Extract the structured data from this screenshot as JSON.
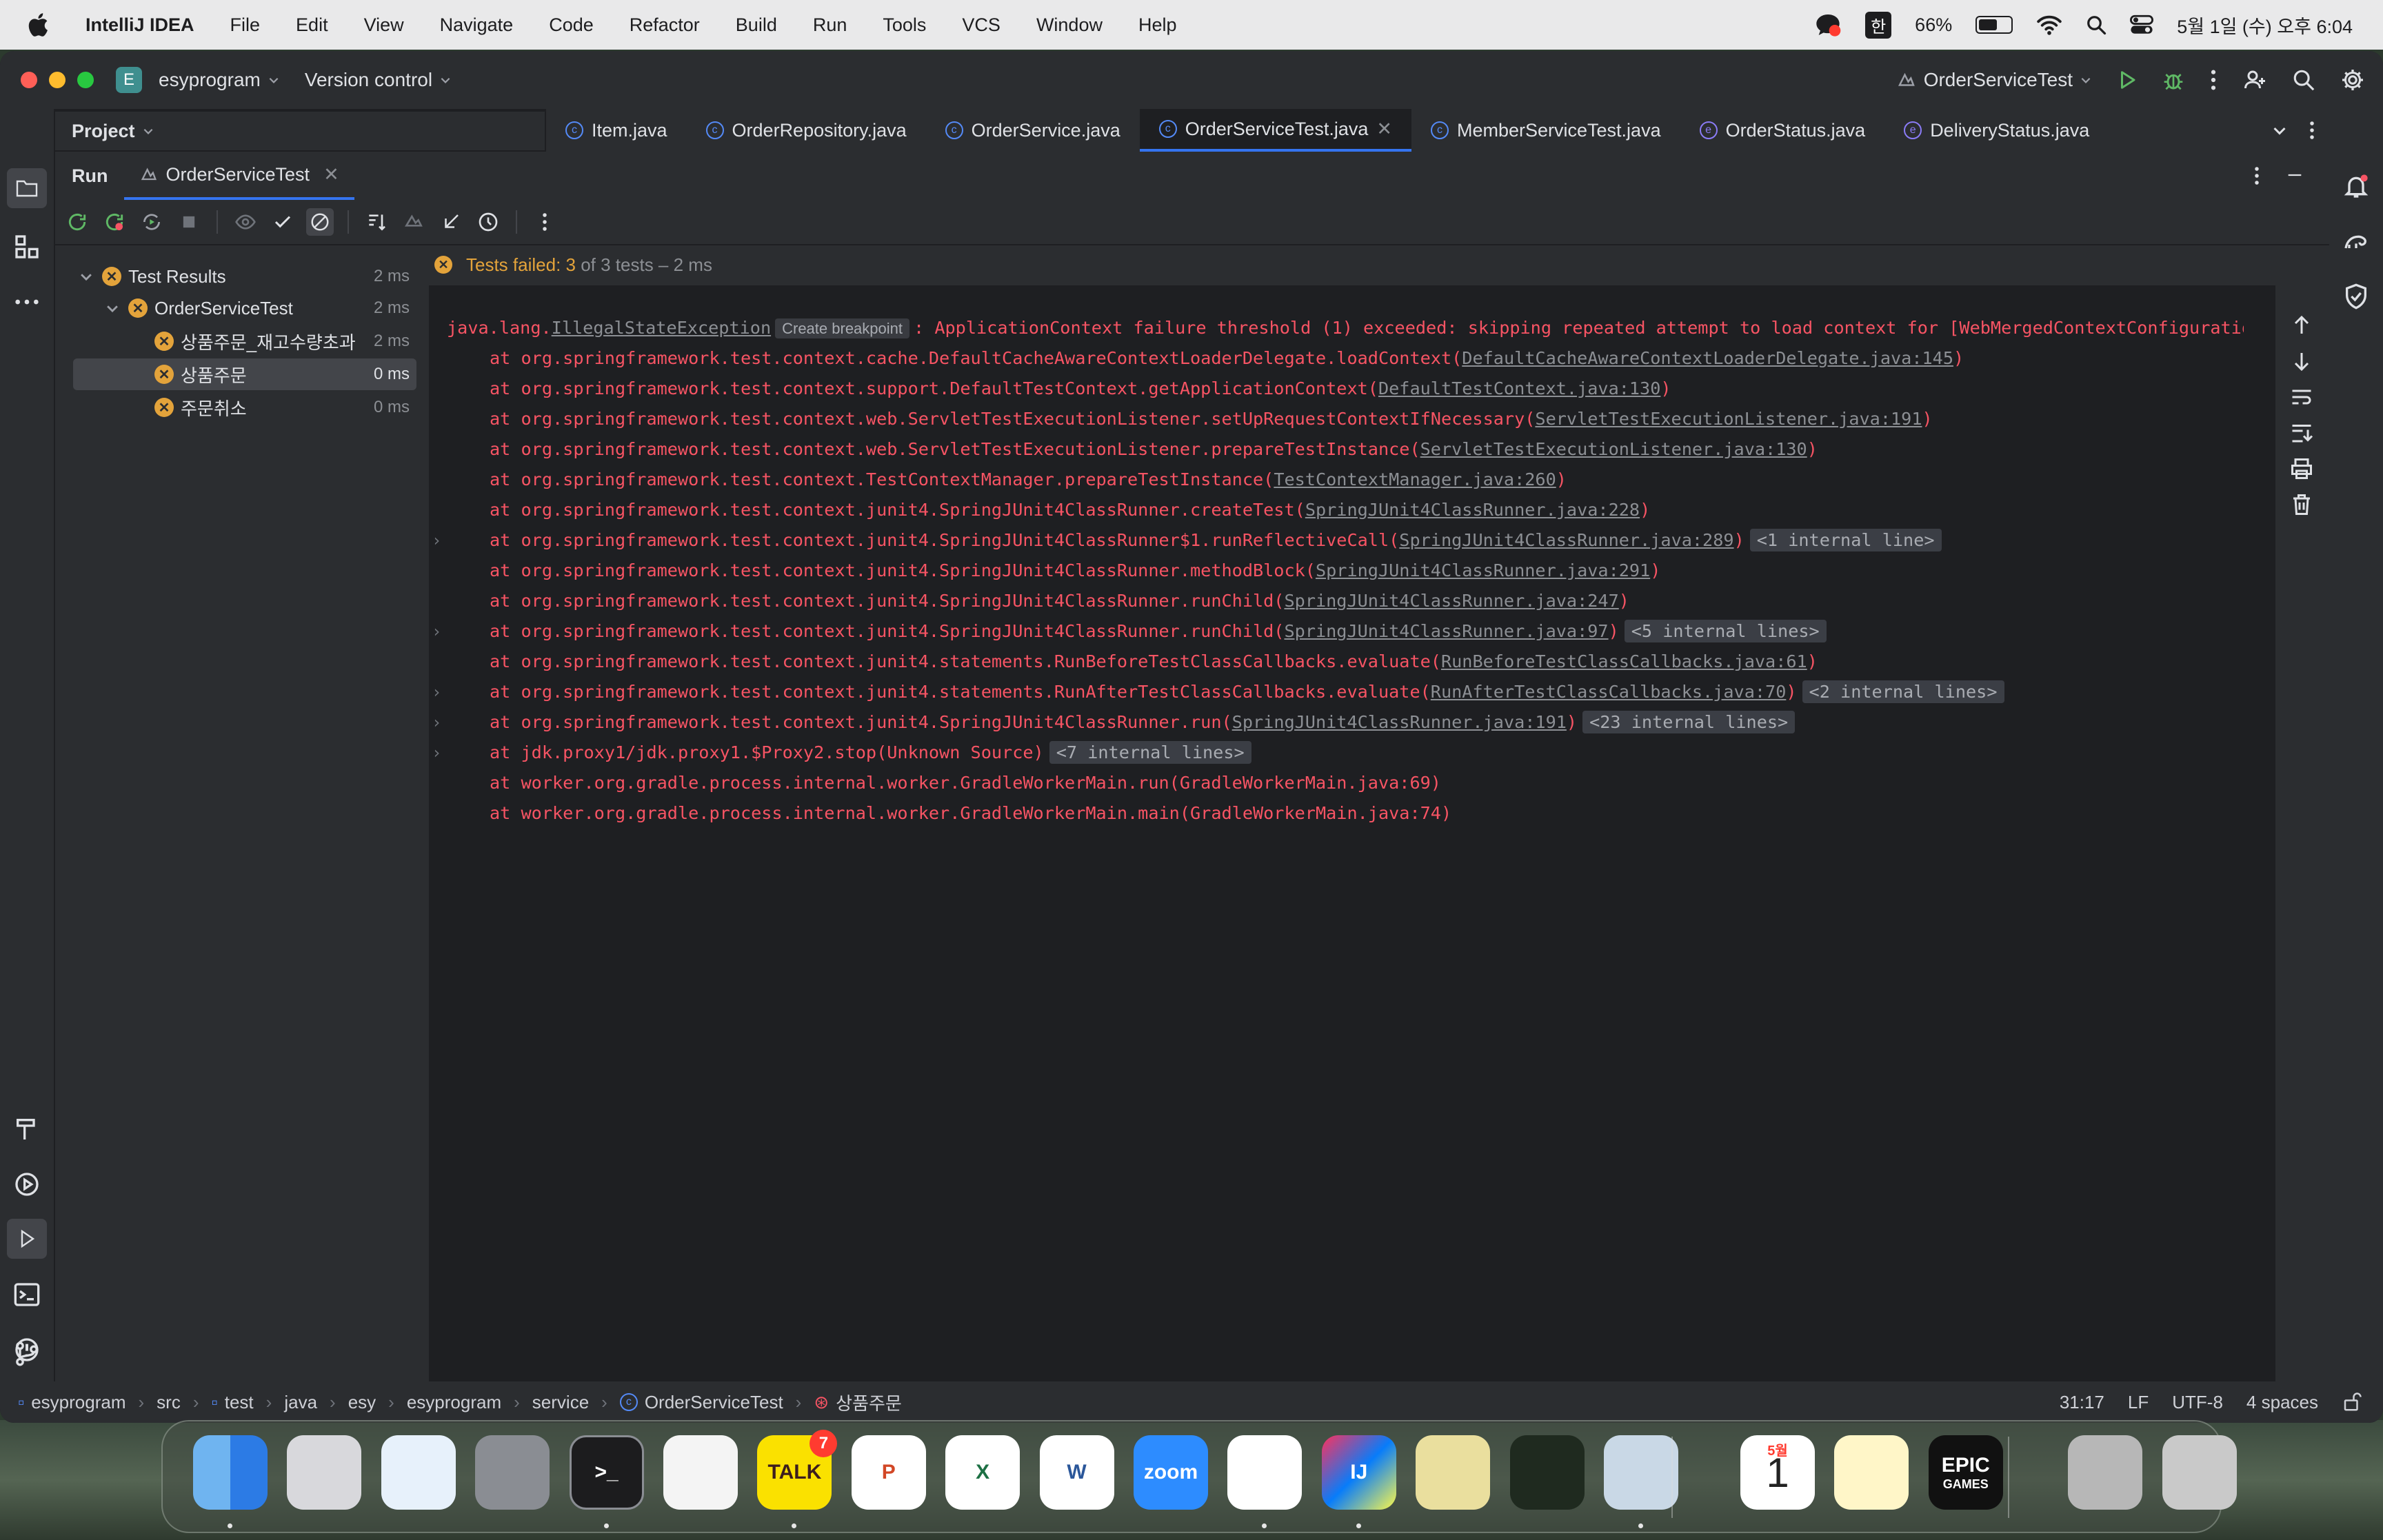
{
  "menubar": {
    "app_name": "IntelliJ IDEA",
    "items": [
      "File",
      "Edit",
      "View",
      "Navigate",
      "Code",
      "Refactor",
      "Build",
      "Run",
      "Tools",
      "VCS",
      "Window",
      "Help"
    ],
    "input_source": "한",
    "battery_percent": "66%",
    "battery_level": 0.66,
    "datetime": "5월 1일 (수) 오후 6:04"
  },
  "titlebar": {
    "project_badge": "E",
    "project_name": "esyprogram",
    "vcs_label": "Version control",
    "run_config": "OrderServiceTest"
  },
  "project_panel": {
    "title": "Project"
  },
  "editor_tabs": [
    {
      "label": "Item.java",
      "kind": "class"
    },
    {
      "label": "OrderRepository.java",
      "kind": "class"
    },
    {
      "label": "OrderService.java",
      "kind": "class"
    },
    {
      "label": "OrderServiceTest.java",
      "kind": "class",
      "active": true
    },
    {
      "label": "MemberServiceTest.java",
      "kind": "class"
    },
    {
      "label": "OrderStatus.java",
      "kind": "enum"
    },
    {
      "label": "DeliveryStatus.java",
      "kind": "enum"
    }
  ],
  "run_panel": {
    "label": "Run",
    "tab": "OrderServiceTest"
  },
  "test_tree": [
    {
      "name": "Test Results",
      "time": "2 ms",
      "level": 0
    },
    {
      "name": "OrderServiceTest",
      "time": "2 ms",
      "level": 1
    },
    {
      "name": "상품주문_재고수량초과",
      "time": "2 ms",
      "level": 2
    },
    {
      "name": "상품주문",
      "time": "0 ms",
      "level": 2,
      "selected": true
    },
    {
      "name": "주문취소",
      "time": "0 ms",
      "level": 2
    }
  ],
  "console": {
    "status_prefix": "Tests failed: ",
    "status_count": "3",
    "status_suffix": " of 3 tests – 2 ms",
    "exception_pkg": "java.lang.",
    "exception_class": "IllegalStateException",
    "breakpoint_hint": "Create breakpoint",
    "exception_msg": ": ApplicationContext failure threshold (1) exceeded: skipping repeated attempt to load context for [WebMergedContextConfiguration",
    "frames": [
      {
        "text": "at org.springframework.test.context.cache.DefaultCacheAwareContextLoaderDelegate.loadContext(",
        "link": "DefaultCacheAwareContextLoaderDelegate.java:145",
        "tail": ")",
        "internal": "",
        "fold": false
      },
      {
        "text": "at org.springframework.test.context.support.DefaultTestContext.getApplicationContext(",
        "link": "DefaultTestContext.java:130",
        "tail": ")",
        "internal": "",
        "fold": false
      },
      {
        "text": "at org.springframework.test.context.web.ServletTestExecutionListener.setUpRequestContextIfNecessary(",
        "link": "ServletTestExecutionListener.java:191",
        "tail": ")",
        "internal": "",
        "fold": false
      },
      {
        "text": "at org.springframework.test.context.web.ServletTestExecutionListener.prepareTestInstance(",
        "link": "ServletTestExecutionListener.java:130",
        "tail": ")",
        "internal": "",
        "fold": false
      },
      {
        "text": "at org.springframework.test.context.TestContextManager.prepareTestInstance(",
        "link": "TestContextManager.java:260",
        "tail": ")",
        "internal": "",
        "fold": false
      },
      {
        "text": "at org.springframework.test.context.junit4.SpringJUnit4ClassRunner.createTest(",
        "link": "SpringJUnit4ClassRunner.java:228",
        "tail": ")",
        "internal": "",
        "fold": false
      },
      {
        "text": "at org.springframework.test.context.junit4.SpringJUnit4ClassRunner$1.runReflectiveCall(",
        "link": "SpringJUnit4ClassRunner.java:289",
        "tail": ")",
        "internal": "<1 internal line>",
        "fold": true
      },
      {
        "text": "at org.springframework.test.context.junit4.SpringJUnit4ClassRunner.methodBlock(",
        "link": "SpringJUnit4ClassRunner.java:291",
        "tail": ")",
        "internal": "",
        "fold": false
      },
      {
        "text": "at org.springframework.test.context.junit4.SpringJUnit4ClassRunner.runChild(",
        "link": "SpringJUnit4ClassRunner.java:247",
        "tail": ")",
        "internal": "",
        "fold": false
      },
      {
        "text": "at org.springframework.test.context.junit4.SpringJUnit4ClassRunner.runChild(",
        "link": "SpringJUnit4ClassRunner.java:97",
        "tail": ")",
        "internal": "<5 internal lines>",
        "fold": true
      },
      {
        "text": "at org.springframework.test.context.junit4.statements.RunBeforeTestClassCallbacks.evaluate(",
        "link": "RunBeforeTestClassCallbacks.java:61",
        "tail": ")",
        "internal": "",
        "fold": false
      },
      {
        "text": "at org.springframework.test.context.junit4.statements.RunAfterTestClassCallbacks.evaluate(",
        "link": "RunAfterTestClassCallbacks.java:70",
        "tail": ")",
        "internal": "<2 internal lines>",
        "fold": true
      },
      {
        "text": "at org.springframework.test.context.junit4.SpringJUnit4ClassRunner.run(",
        "link": "SpringJUnit4ClassRunner.java:191",
        "tail": ")",
        "internal": "<23 internal lines>",
        "fold": true
      },
      {
        "text": "at jdk.proxy1/jdk.proxy1.$Proxy2.stop(Unknown Source)",
        "link": "",
        "tail": "",
        "internal": "<7 internal lines>",
        "fold": true
      },
      {
        "text": "at worker.org.gradle.process.internal.worker.GradleWorkerMain.run(GradleWorkerMain.java:69)",
        "link": "",
        "tail": "",
        "internal": "",
        "fold": false
      },
      {
        "text": "at worker.org.gradle.process.internal.worker.GradleWorkerMain.main(GradleWorkerMain.java:74)",
        "link": "",
        "tail": "",
        "internal": "",
        "fold": false
      }
    ]
  },
  "statusbar": {
    "breadcrumbs": [
      "esyprogram",
      "src",
      "test",
      "java",
      "esy",
      "esyprogram",
      "service",
      "OrderServiceTest",
      "상품주문"
    ],
    "position": "31:17",
    "line_sep": "LF",
    "encoding": "UTF-8",
    "indent": "4 spaces"
  },
  "dock": {
    "apps": [
      {
        "name": "Finder",
        "label": ""
      },
      {
        "name": "Launchpad",
        "label": ""
      },
      {
        "name": "Safari",
        "label": ""
      },
      {
        "name": "System Settings",
        "label": ""
      },
      {
        "name": "Terminal",
        "label": ">_"
      },
      {
        "name": "TextEdit",
        "label": ""
      },
      {
        "name": "KakaoTalk",
        "label": "TALK",
        "badge": "7"
      },
      {
        "name": "PowerPoint",
        "label": "P"
      },
      {
        "name": "Excel",
        "label": "X"
      },
      {
        "name": "Word",
        "label": "W"
      },
      {
        "name": "Zoom",
        "label": "zoom"
      },
      {
        "name": "Chrome",
        "label": ""
      },
      {
        "name": "IntelliJ IDEA",
        "label": "IJ"
      },
      {
        "name": "Python Launcher",
        "label": ""
      },
      {
        "name": "Activity",
        "label": ""
      },
      {
        "name": "Preview",
        "label": ""
      },
      {
        "name": "Calendar",
        "label": "1",
        "month": "5월"
      },
      {
        "name": "Notes",
        "label": ""
      },
      {
        "name": "Epic Games",
        "label": "EPIC",
        "sub": "GAMES"
      },
      {
        "name": "Downloads",
        "label": ""
      },
      {
        "name": "Trash",
        "label": ""
      }
    ]
  },
  "colors": {
    "error_red": "#f75464",
    "warning_orange": "#e3a33b",
    "accent_blue": "#3574f0",
    "run_green": "#5fb865"
  }
}
